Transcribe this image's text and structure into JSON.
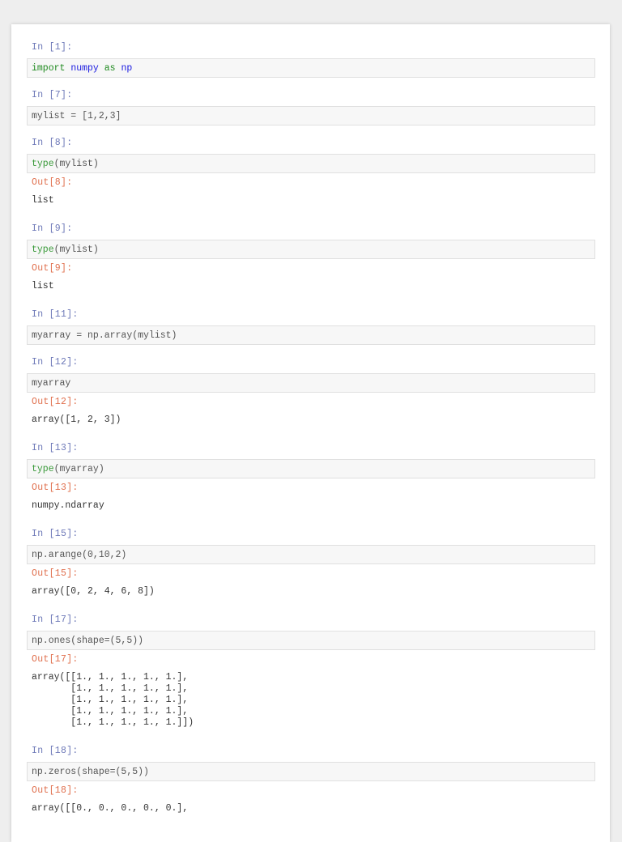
{
  "cells": [
    {
      "in": "In [1]:",
      "code": [
        {
          "t": "import",
          "c": "kw"
        },
        {
          "t": " "
        },
        {
          "t": "numpy",
          "c": "nm"
        },
        {
          "t": " "
        },
        {
          "t": "as",
          "c": "kw"
        },
        {
          "t": " "
        },
        {
          "t": "np",
          "c": "nm"
        }
      ]
    },
    {
      "in": "In [7]:",
      "code": [
        {
          "t": "mylist = [1,2,3]"
        }
      ]
    },
    {
      "in": "In [8]:",
      "code": [
        {
          "t": "type",
          "c": "bi"
        },
        {
          "t": "(mylist)"
        }
      ],
      "out": "Out[8]:",
      "result": "list"
    },
    {
      "in": "In [9]:",
      "code": [
        {
          "t": "type",
          "c": "bi"
        },
        {
          "t": "(mylist)"
        }
      ],
      "out": "Out[9]:",
      "result": "list"
    },
    {
      "in": "In [11]:",
      "code": [
        {
          "t": "myarray = np.array(mylist)"
        }
      ]
    },
    {
      "in": "In [12]:",
      "code": [
        {
          "t": "myarray"
        }
      ],
      "out": "Out[12]:",
      "result": "array([1, 2, 3])"
    },
    {
      "in": "In [13]:",
      "code": [
        {
          "t": "type",
          "c": "bi"
        },
        {
          "t": "(myarray)"
        }
      ],
      "out": "Out[13]:",
      "result": "numpy.ndarray"
    },
    {
      "in": "In [15]:",
      "code": [
        {
          "t": "np.arange(0,10,2)"
        }
      ],
      "out": "Out[15]:",
      "result": "array([0, 2, 4, 6, 8])"
    },
    {
      "in": "In [17]:",
      "code": [
        {
          "t": "np.ones(shape=(5,5))"
        }
      ],
      "out": "Out[17]:",
      "result": "array([[1., 1., 1., 1., 1.],\n       [1., 1., 1., 1., 1.],\n       [1., 1., 1., 1., 1.],\n       [1., 1., 1., 1., 1.],\n       [1., 1., 1., 1., 1.]])"
    },
    {
      "in": "In [18]:",
      "code": [
        {
          "t": "np.zeros(shape=(5,5))"
        }
      ],
      "out": "Out[18]:",
      "result": "array([[0., 0., 0., 0., 0.],"
    }
  ]
}
